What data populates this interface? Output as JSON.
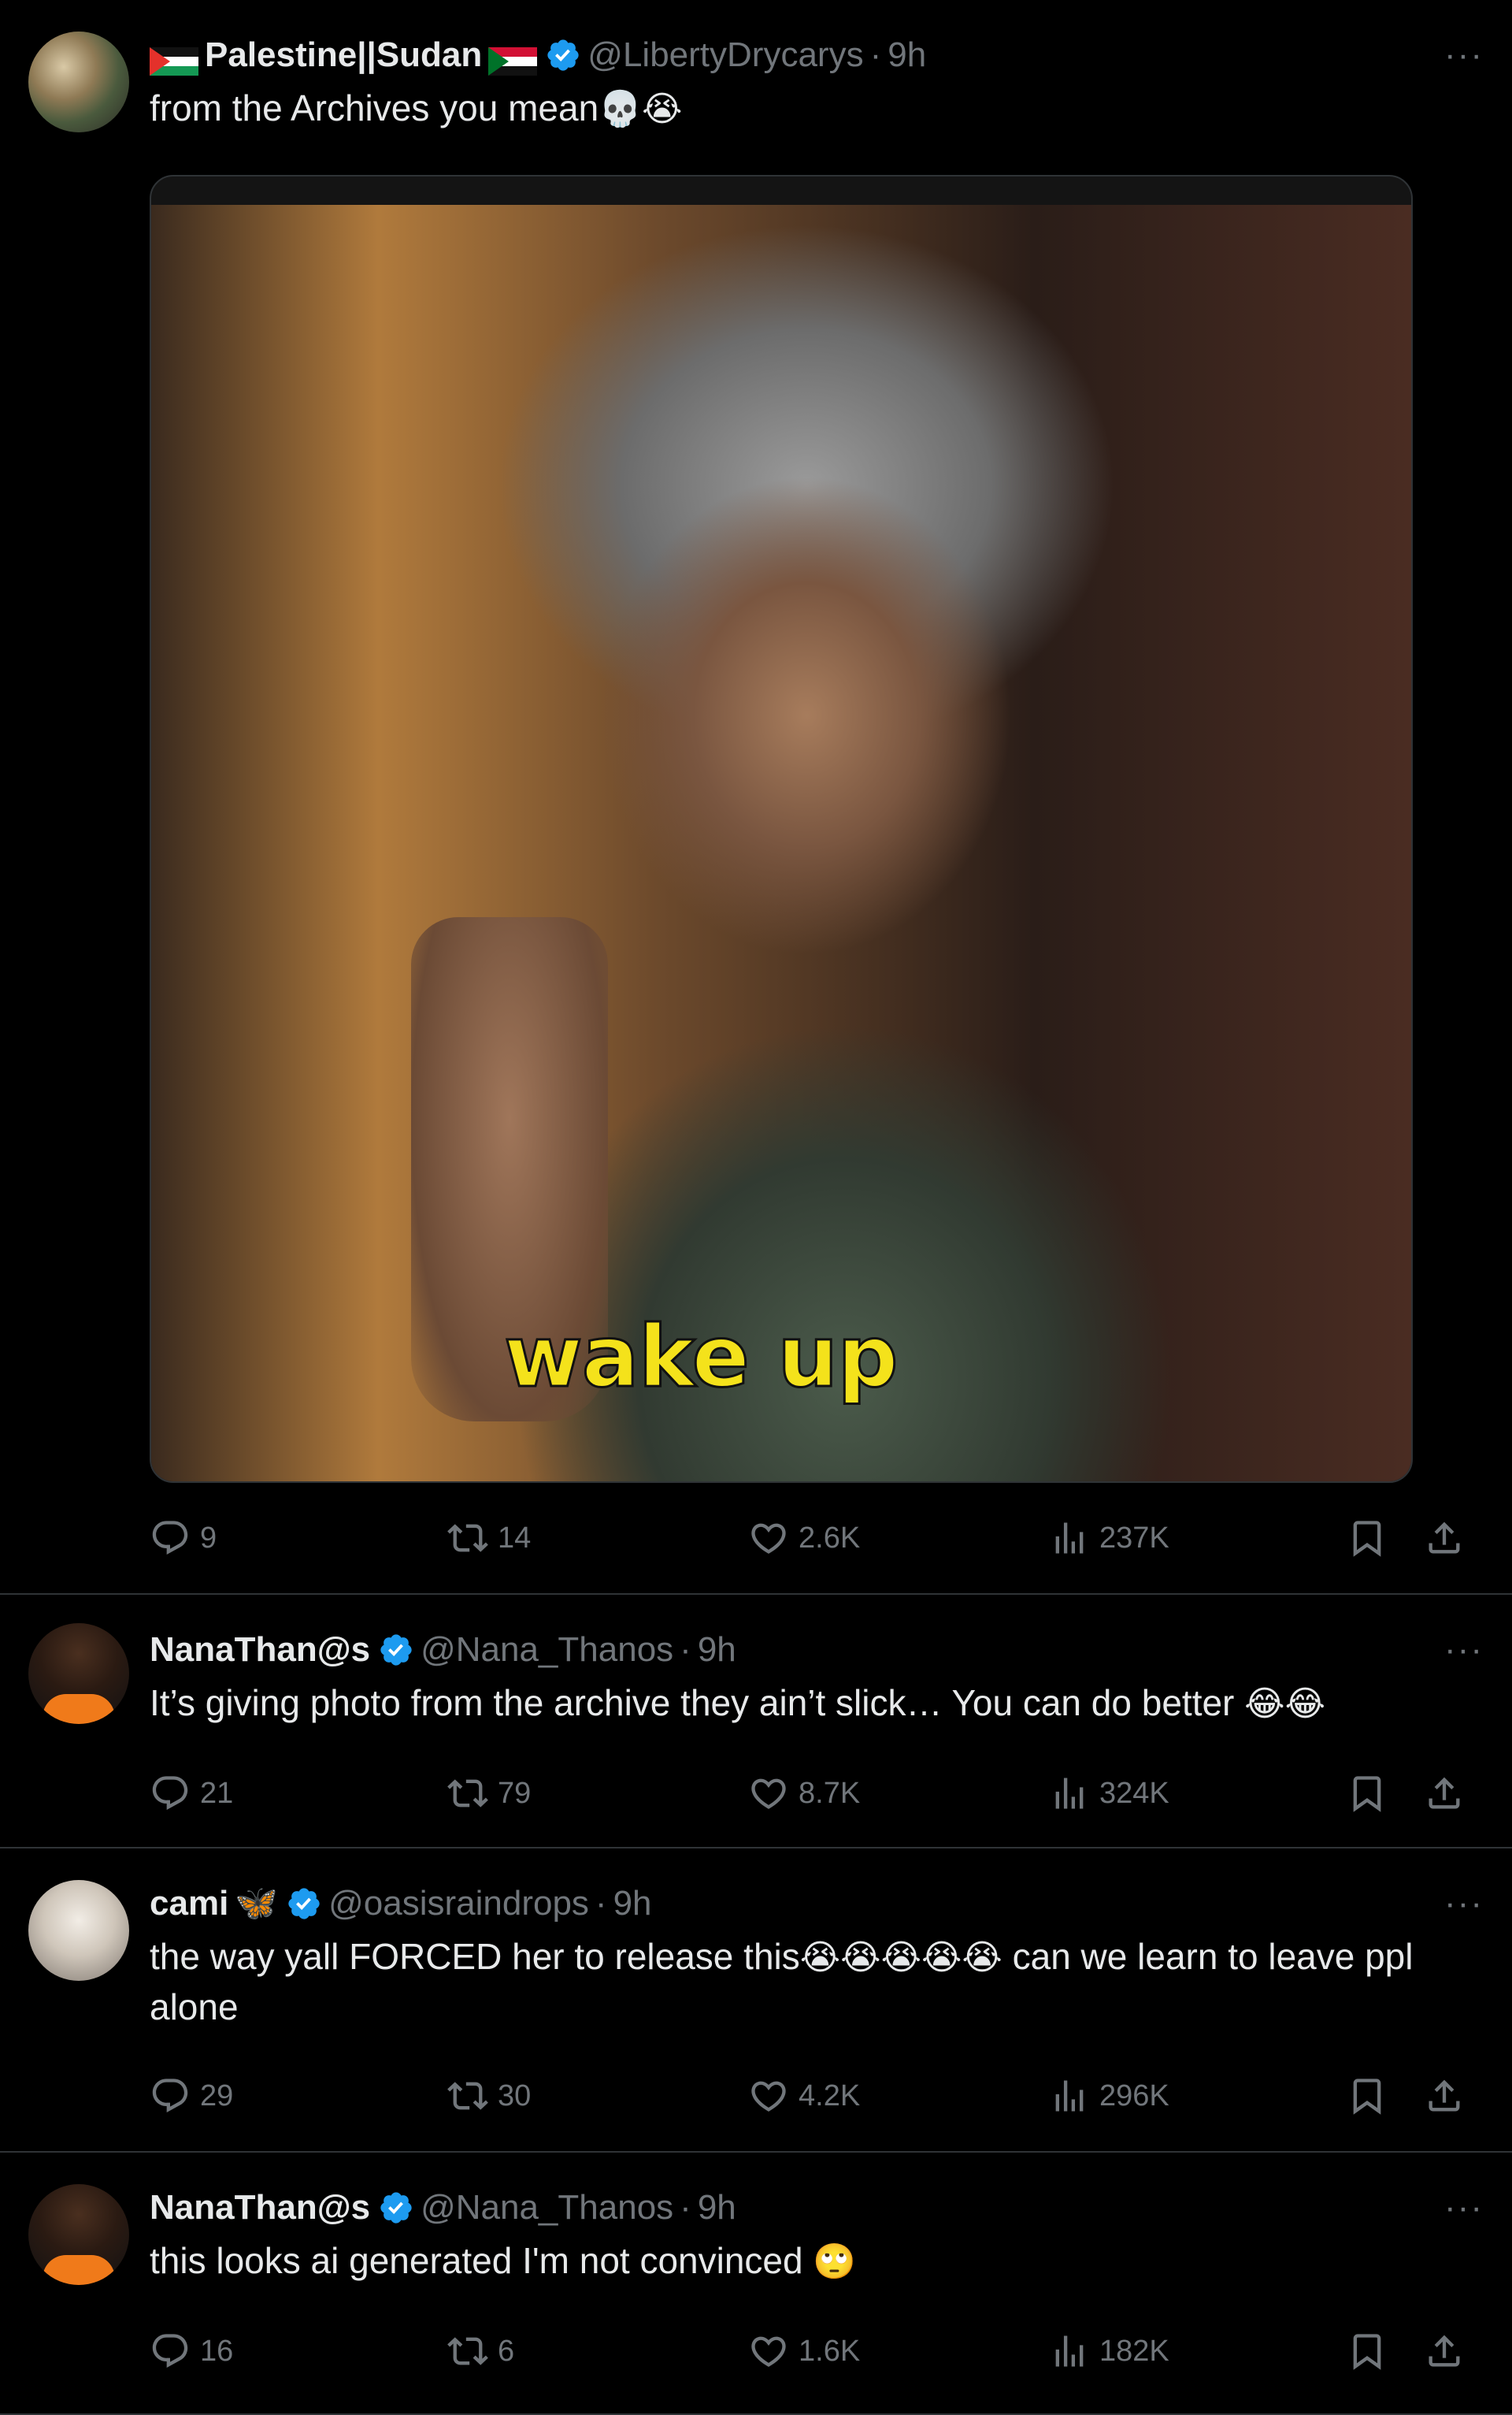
{
  "tweets": [
    {
      "display_name": "Palestine||Sudan",
      "handle": "@LibertyDrycarys",
      "time": "9h",
      "text": "from the Archives you mean",
      "text_emojis": "💀😭",
      "media_caption": "wake up",
      "stats": {
        "replies": "9",
        "retweets": "14",
        "likes": "2.6K",
        "views": "237K"
      }
    },
    {
      "display_name": "NanaThan@s",
      "handle": "@Nana_Thanos",
      "time": "9h",
      "text": "It’s giving photo from the archive they ain’t slick… You can do better",
      "text_emojis": "😂😂",
      "stats": {
        "replies": "21",
        "retweets": "79",
        "likes": "8.7K",
        "views": "324K"
      }
    },
    {
      "display_name": "cami",
      "name_emoji": "🦋",
      "handle": "@oasisraindrops",
      "time": "9h",
      "text_before": "the way yall FORCED her to release this",
      "text_emojis": "😭😭😭😭😭",
      "text_after": " can we learn to leave ppl alone",
      "stats": {
        "replies": "29",
        "retweets": "30",
        "likes": "4.2K",
        "views": "296K"
      }
    },
    {
      "display_name": "NanaThan@s",
      "handle": "@Nana_Thanos",
      "time": "9h",
      "text": "this looks ai generated I'm not convinced",
      "text_emojis": "🙄",
      "stats": {
        "replies": "16",
        "retweets": "6",
        "likes": "1.6K",
        "views": "182K"
      }
    }
  ],
  "ui": {
    "separator": "·",
    "more": "···",
    "verified_color": "#1d9bf0",
    "muted_color": "#71767b",
    "icons": [
      "reply-icon",
      "retweet-icon",
      "like-icon",
      "views-icon",
      "bookmark-icon",
      "share-icon",
      "more-icon",
      "verified-icon"
    ]
  }
}
